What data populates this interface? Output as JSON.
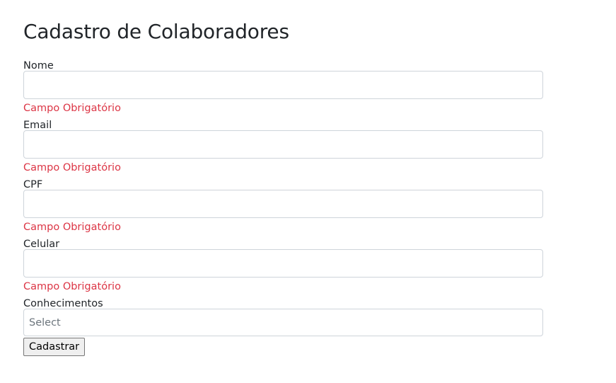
{
  "page": {
    "title": "Cadastro de Colaboradores"
  },
  "form": {
    "fields": [
      {
        "label": "Nome",
        "value": "",
        "error": "Campo Obrigatório"
      },
      {
        "label": "Email",
        "value": "",
        "error": "Campo Obrigatório"
      },
      {
        "label": "CPF",
        "value": "",
        "error": "Campo Obrigatório"
      },
      {
        "label": "Celular",
        "value": "",
        "error": "Campo Obrigatório"
      }
    ],
    "knowledge": {
      "label": "Conhecimentos",
      "placeholder": "Select"
    },
    "submit_label": "Cadastrar"
  },
  "colors": {
    "error": "#dc3545",
    "border": "#ced4da",
    "text": "#212529"
  }
}
